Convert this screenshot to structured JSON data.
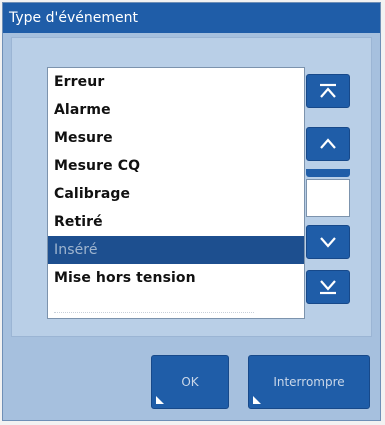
{
  "dialog": {
    "title": "Type d'événement"
  },
  "list": {
    "items": [
      {
        "label": "Erreur",
        "selected": false
      },
      {
        "label": "Alarme",
        "selected": false
      },
      {
        "label": "Mesure",
        "selected": false
      },
      {
        "label": "Mesure CQ",
        "selected": false
      },
      {
        "label": "Calibrage",
        "selected": false
      },
      {
        "label": "Retiré",
        "selected": false
      },
      {
        "label": "Inséré",
        "selected": true
      },
      {
        "label": "Mise hors tension",
        "selected": false
      }
    ]
  },
  "navigation": {
    "top_icon": "scroll-to-top-icon",
    "up_icon": "scroll-up-icon",
    "down_icon": "scroll-down-icon",
    "bottom_icon": "scroll-to-bottom-icon"
  },
  "buttons": {
    "ok_label": "OK",
    "cancel_label": "Interrompre"
  },
  "colors": {
    "title_bar": "#1f5da8",
    "dialog_bg": "#a6c0de",
    "selected_row": "#1d4f8f",
    "button": "#1f5da8"
  }
}
